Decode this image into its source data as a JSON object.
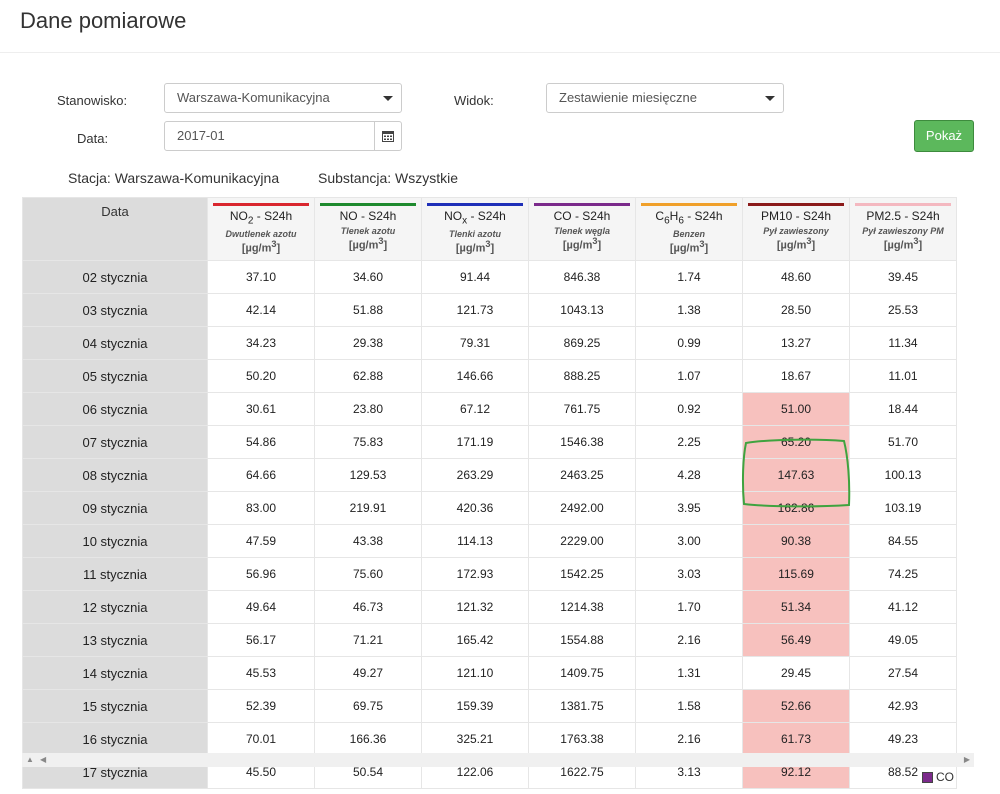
{
  "page": {
    "title": "Dane pomiarowe"
  },
  "form": {
    "stanowisko_label": "Stanowisko:",
    "stanowisko_value": "Warszawa-Komunikacyjna",
    "widok_label": "Widok:",
    "widok_value": "Zestawienie miesięczne",
    "data_label": "Data:",
    "data_value": "2017-01",
    "show_button": "Pokaż"
  },
  "info": {
    "station": "Stacja: Warszawa-Komunikacyjna",
    "substance": "Substancja: Wszystkie"
  },
  "table": {
    "date_header": "Data",
    "columns": [
      {
        "name": "NO2 - S24h",
        "sub": "Dwutlenek azotu",
        "unit": "[µg/m3]",
        "color": "#d9262e"
      },
      {
        "name": "NO - S24h",
        "sub": "Tlenek azotu",
        "unit": "[µg/m3]",
        "color": "#1e8a2e"
      },
      {
        "name": "NOx - S24h",
        "sub": "Tlenki azotu",
        "unit": "[µg/m3]",
        "color": "#1f2fb8"
      },
      {
        "name": "CO - S24h",
        "sub": "Tlenek węgla",
        "unit": "[µg/m3]",
        "color": "#7b2a8b"
      },
      {
        "name": "C6H6 - S24h",
        "sub": "Benzen",
        "unit": "[µg/m3]",
        "color": "#f0a02a"
      },
      {
        "name": "PM10 - S24h",
        "sub": "Pył zawieszony",
        "unit": "[µg/m3]",
        "color": "#8b1a1a"
      },
      {
        "name": "PM2.5 - S24h",
        "sub": "Pył zawieszony PM",
        "unit": "[µg/m3]",
        "color": "#f4b8c0"
      }
    ],
    "rows": [
      {
        "date": "02 stycznia",
        "values": [
          "37.10",
          "34.60",
          "91.44",
          "846.38",
          "1.74",
          "48.60",
          "39.45"
        ],
        "exceed": [
          false,
          false,
          false,
          false,
          false,
          false,
          false
        ]
      },
      {
        "date": "03 stycznia",
        "values": [
          "42.14",
          "51.88",
          "121.73",
          "1043.13",
          "1.38",
          "28.50",
          "25.53"
        ],
        "exceed": [
          false,
          false,
          false,
          false,
          false,
          false,
          false
        ]
      },
      {
        "date": "04 stycznia",
        "values": [
          "34.23",
          "29.38",
          "79.31",
          "869.25",
          "0.99",
          "13.27",
          "11.34"
        ],
        "exceed": [
          false,
          false,
          false,
          false,
          false,
          false,
          false
        ]
      },
      {
        "date": "05 stycznia",
        "values": [
          "50.20",
          "62.88",
          "146.66",
          "888.25",
          "1.07",
          "18.67",
          "11.01"
        ],
        "exceed": [
          false,
          false,
          false,
          false,
          false,
          false,
          false
        ]
      },
      {
        "date": "06 stycznia",
        "values": [
          "30.61",
          "23.80",
          "67.12",
          "761.75",
          "0.92",
          "51.00",
          "18.44"
        ],
        "exceed": [
          false,
          false,
          false,
          false,
          false,
          true,
          false
        ]
      },
      {
        "date": "07 stycznia",
        "values": [
          "54.86",
          "75.83",
          "171.19",
          "1546.38",
          "2.25",
          "65.20",
          "51.70"
        ],
        "exceed": [
          false,
          false,
          false,
          false,
          false,
          true,
          false
        ]
      },
      {
        "date": "08 stycznia",
        "values": [
          "64.66",
          "129.53",
          "263.29",
          "2463.25",
          "4.28",
          "147.63",
          "100.13"
        ],
        "exceed": [
          false,
          false,
          false,
          false,
          false,
          true,
          false
        ]
      },
      {
        "date": "09 stycznia",
        "values": [
          "83.00",
          "219.91",
          "420.36",
          "2492.00",
          "3.95",
          "162.86",
          "103.19"
        ],
        "exceed": [
          false,
          false,
          false,
          false,
          false,
          true,
          false
        ]
      },
      {
        "date": "10 stycznia",
        "values": [
          "47.59",
          "43.38",
          "114.13",
          "2229.00",
          "3.00",
          "90.38",
          "84.55"
        ],
        "exceed": [
          false,
          false,
          false,
          false,
          false,
          true,
          false
        ]
      },
      {
        "date": "11 stycznia",
        "values": [
          "56.96",
          "75.60",
          "172.93",
          "1542.25",
          "3.03",
          "115.69",
          "74.25"
        ],
        "exceed": [
          false,
          false,
          false,
          false,
          false,
          true,
          false
        ]
      },
      {
        "date": "12 stycznia",
        "values": [
          "49.64",
          "46.73",
          "121.32",
          "1214.38",
          "1.70",
          "51.34",
          "41.12"
        ],
        "exceed": [
          false,
          false,
          false,
          false,
          false,
          true,
          false
        ]
      },
      {
        "date": "13 stycznia",
        "values": [
          "56.17",
          "71.21",
          "165.42",
          "1554.88",
          "2.16",
          "56.49",
          "49.05"
        ],
        "exceed": [
          false,
          false,
          false,
          false,
          false,
          true,
          false
        ]
      },
      {
        "date": "14 stycznia",
        "values": [
          "45.53",
          "49.27",
          "121.10",
          "1409.75",
          "1.31",
          "29.45",
          "27.54"
        ],
        "exceed": [
          false,
          false,
          false,
          false,
          false,
          false,
          false
        ]
      },
      {
        "date": "15 stycznia",
        "values": [
          "52.39",
          "69.75",
          "159.39",
          "1381.75",
          "1.58",
          "52.66",
          "42.93"
        ],
        "exceed": [
          false,
          false,
          false,
          false,
          false,
          true,
          false
        ]
      },
      {
        "date": "16 stycznia",
        "values": [
          "70.01",
          "166.36",
          "325.21",
          "1763.38",
          "2.16",
          "61.73",
          "49.23"
        ],
        "exceed": [
          false,
          false,
          false,
          false,
          false,
          true,
          false
        ]
      },
      {
        "date": "17 stycznia",
        "values": [
          "45.50",
          "50.54",
          "122.06",
          "1622.75",
          "3.13",
          "92.12",
          "88.52"
        ],
        "exceed": [
          false,
          false,
          false,
          false,
          false,
          true,
          false
        ]
      }
    ]
  },
  "legend": {
    "label": "CO",
    "color": "#7b2a8b"
  }
}
